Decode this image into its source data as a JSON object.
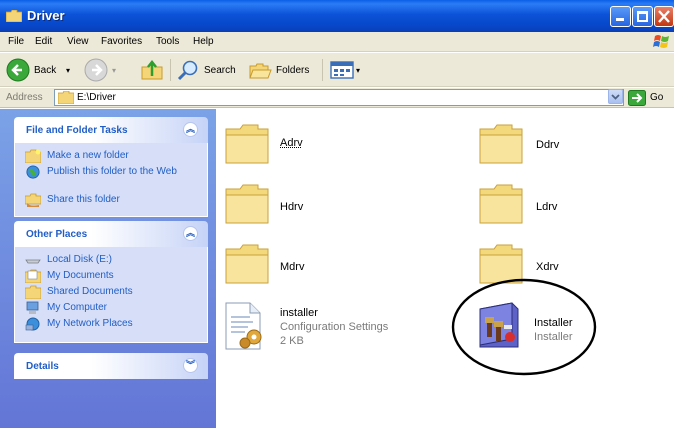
{
  "window": {
    "title": "Driver"
  },
  "menu": [
    "File",
    "Edit",
    "View",
    "Favorites",
    "Tools",
    "Help"
  ],
  "toolbar": {
    "back": "Back",
    "search": "Search",
    "folders": "Folders"
  },
  "address": {
    "label": "Address",
    "value": "E:\\Driver",
    "go": "Go"
  },
  "tasks": {
    "title": "File and Folder Tasks",
    "items": [
      "Make a new folder",
      "Publish this folder to the Web",
      "Share this folder"
    ]
  },
  "places": {
    "title": "Other Places",
    "items": [
      "Local Disk (E:)",
      "My Documents",
      "Shared Documents",
      "My Computer",
      "My Network Places"
    ]
  },
  "details": {
    "title": "Details"
  },
  "files": {
    "adrv": "Adrv",
    "ddrv": "Ddrv",
    "hdrv": "Hdrv",
    "ldrv": "Ldrv",
    "mdrv": "Mdrv",
    "xdrv": "Xdrv",
    "config": {
      "name": "installer",
      "type": "Configuration Settings",
      "size": "2 KB"
    },
    "app": {
      "name": "Installer",
      "desc": "Installer"
    }
  },
  "colors": {
    "accent": "#215dc6",
    "titlebar": "#0a52d6",
    "pane": "#6f8ce0"
  }
}
